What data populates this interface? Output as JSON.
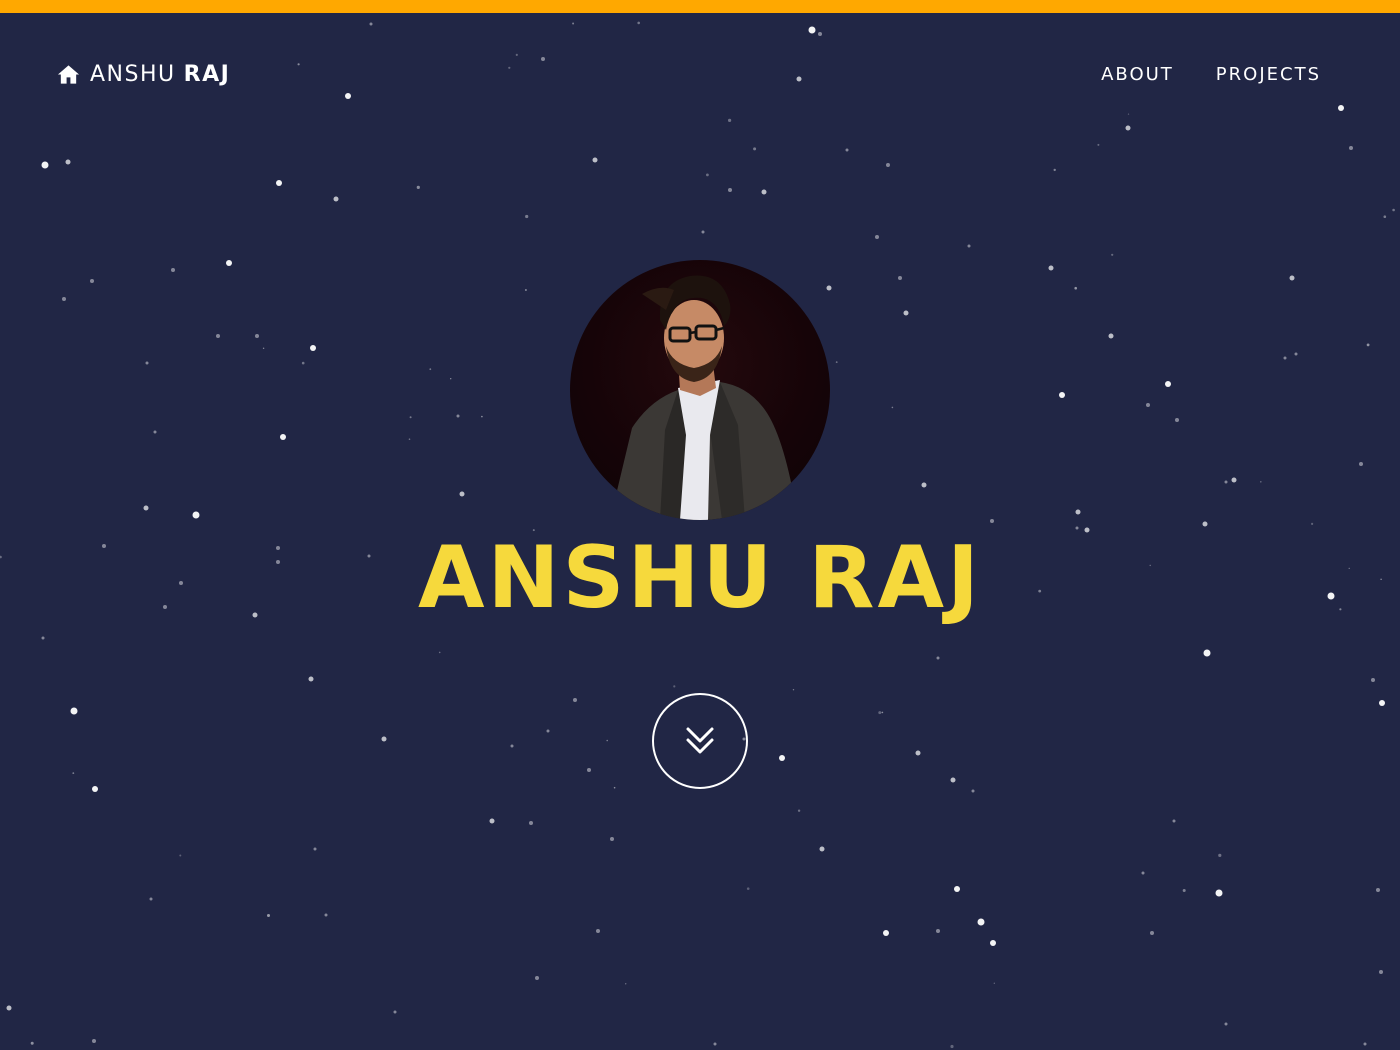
{
  "colors": {
    "background": "#212645",
    "top_strip": "#ffa800",
    "hero_name": "#f6d93c",
    "nav_text": "#ffffff"
  },
  "navbar": {
    "brand": {
      "icon": "home-icon",
      "first": "ANSHU",
      "last": "RAJ"
    },
    "links": [
      {
        "label": "ABOUT"
      },
      {
        "label": "PROJECTS"
      }
    ]
  },
  "hero": {
    "avatar_alt": "profile photo",
    "name": "ANSHU RAJ",
    "scroll_icon": "double-chevron-down-icon"
  }
}
